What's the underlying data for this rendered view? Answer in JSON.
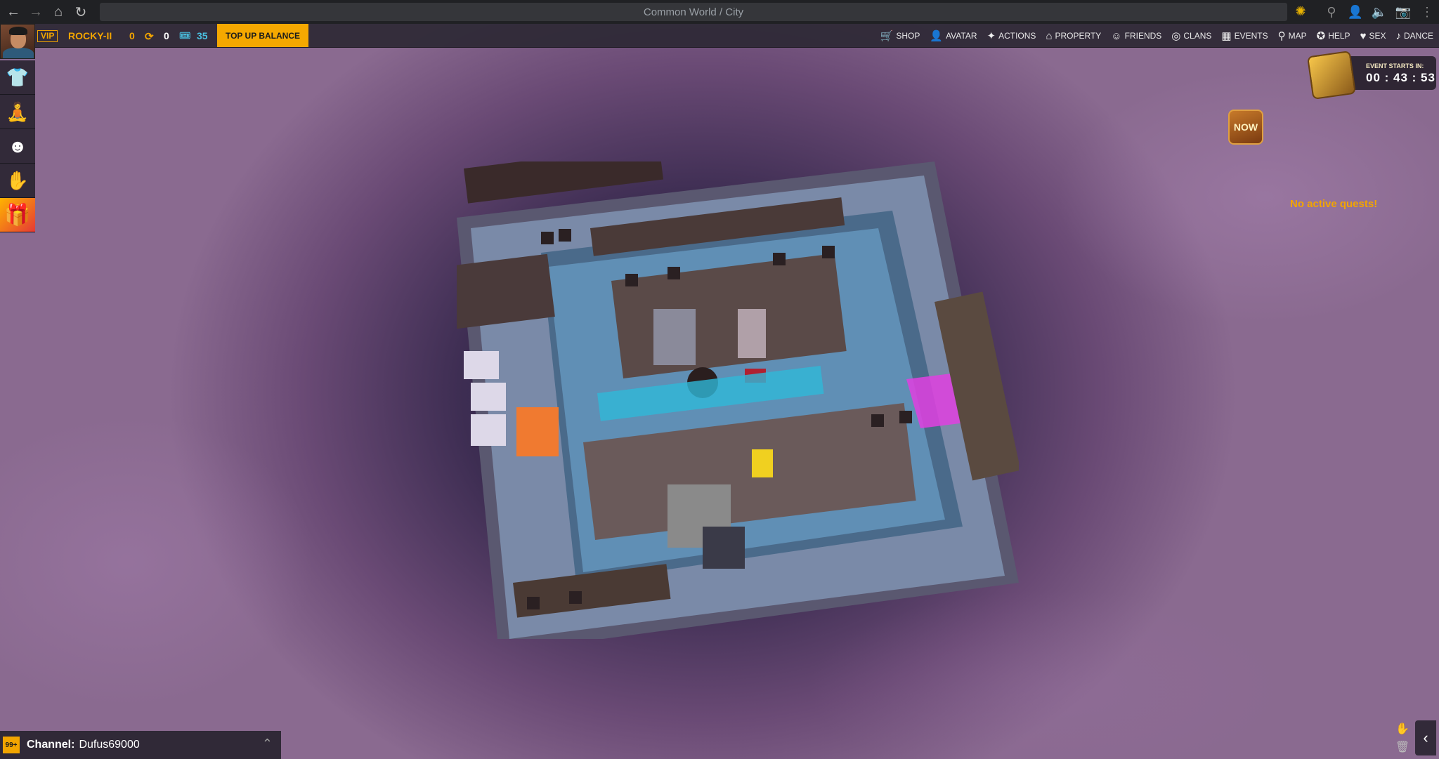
{
  "browser": {
    "address": "Common World / City",
    "icons": [
      "back-icon",
      "forward-icon",
      "home-icon",
      "reload-icon",
      "spinner-icon",
      "location-icon",
      "user-icon",
      "volume-icon",
      "camera-icon",
      "more-icon"
    ]
  },
  "player": {
    "vip": "VIP",
    "name": "ROCKY-II",
    "coins": "0",
    "tokens": "0",
    "tickets": "35",
    "topup": "TOP UP BALANCE"
  },
  "menu": [
    {
      "label": "SHOP",
      "icon": "cart-icon",
      "glyph": "🛒"
    },
    {
      "label": "AVATAR",
      "icon": "person-icon",
      "glyph": "👤"
    },
    {
      "label": "ACTIONS",
      "icon": "actions-icon",
      "glyph": "✦"
    },
    {
      "label": "PROPERTY",
      "icon": "house-icon",
      "glyph": "⌂"
    },
    {
      "label": "FRIENDS",
      "icon": "friends-icon",
      "glyph": "☺"
    },
    {
      "label": "CLANS",
      "icon": "clans-icon",
      "glyph": "◎"
    },
    {
      "label": "EVENTS",
      "icon": "calendar-icon",
      "glyph": "▦"
    },
    {
      "label": "MAP",
      "icon": "map-pin-icon",
      "glyph": "⚲"
    },
    {
      "label": "HELP",
      "icon": "help-icon",
      "glyph": "✪"
    },
    {
      "label": "SEX",
      "icon": "heart-icon",
      "glyph": "♥"
    },
    {
      "label": "DANCE",
      "icon": "dance-icon",
      "glyph": "♪"
    }
  ],
  "tools": [
    {
      "name": "clothes-tool",
      "icon": "shirt-icon",
      "glyph": "👕"
    },
    {
      "name": "pose-tool",
      "icon": "meditate-icon",
      "glyph": "🧘"
    },
    {
      "name": "emote-tool",
      "icon": "smiley-icon",
      "glyph": "☻"
    },
    {
      "name": "interaction-tool",
      "icon": "hand-icon",
      "glyph": "✋"
    },
    {
      "name": "gift-tool",
      "icon": "gift-icon",
      "glyph": "🎁"
    }
  ],
  "event": {
    "label": "EVENT STARTS IN:",
    "timer": "00 : 43 : 53"
  },
  "now_badge": "NOW",
  "quests": "No active quests!",
  "chat": {
    "badge": "99+",
    "label": "Channel:",
    "value": "Dufus69000"
  },
  "colors": {
    "accent": "#f2a500",
    "bar": "#2c2834",
    "water": "#6ab0d8",
    "neon": "#e040e0"
  }
}
